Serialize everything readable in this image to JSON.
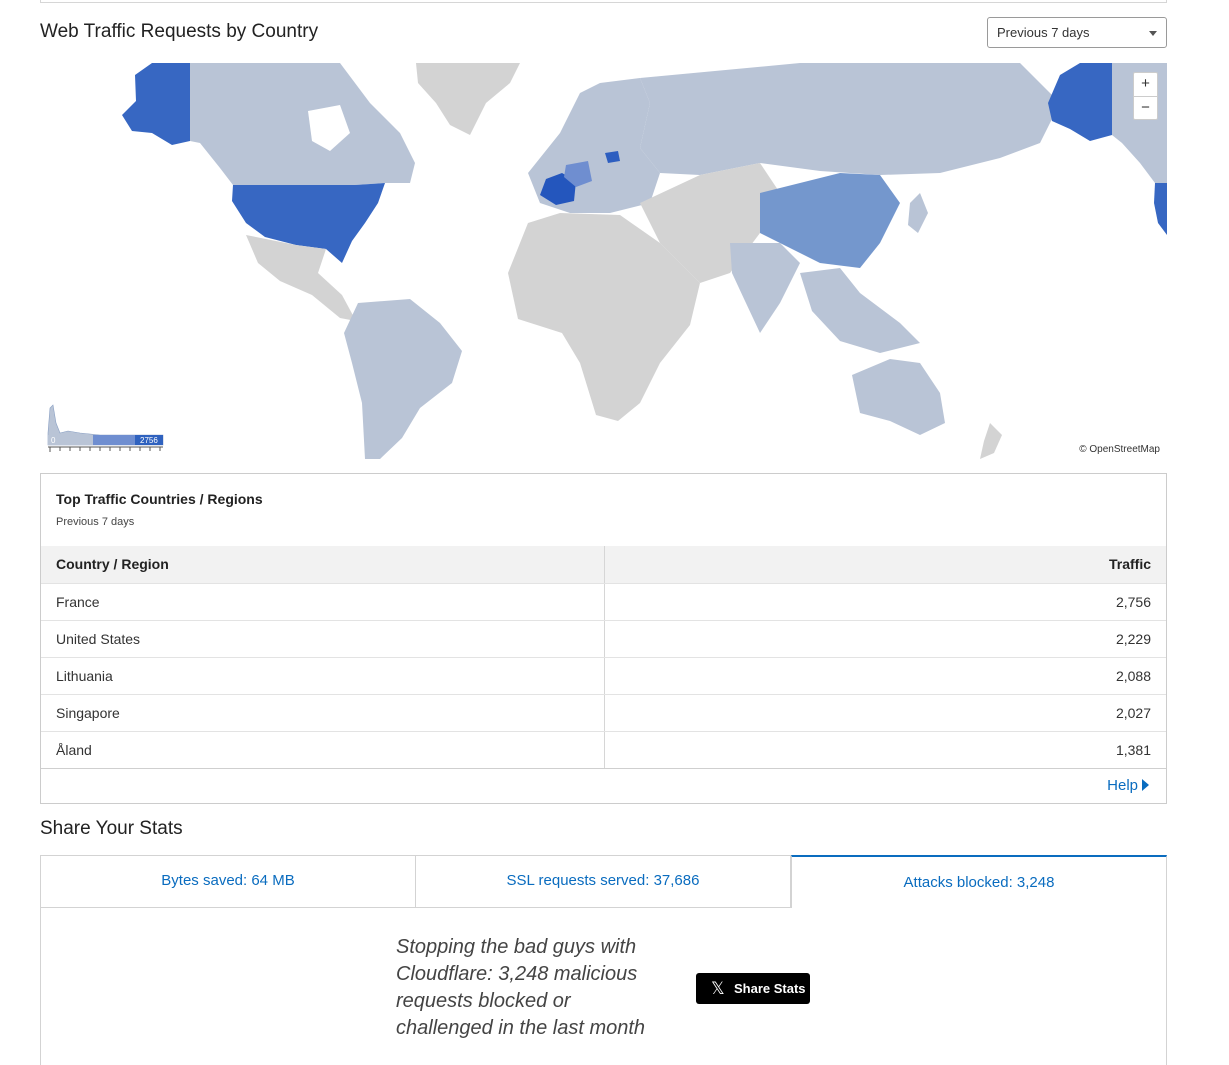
{
  "traffic": {
    "title": "Web Traffic Requests by Country",
    "period_select": "Previous 7 days"
  },
  "map": {
    "zoom_in": "+",
    "zoom_out": "−",
    "attribution": "© OpenStreetMap",
    "legend_min": "0",
    "legend_max": "2756",
    "colors": {
      "land": "#d3d3d3",
      "light": "#b9c4d6",
      "mid": "#8aa5d3",
      "high": "#5d84cb",
      "top": "#2f62bf"
    }
  },
  "top_countries": {
    "title": "Top Traffic Countries / Regions",
    "subtitle": "Previous 7 days",
    "headers": [
      "Country / Region",
      "Traffic"
    ],
    "rows": [
      {
        "country": "France",
        "traffic": "2,756"
      },
      {
        "country": "United States",
        "traffic": "2,229"
      },
      {
        "country": "Lithuania",
        "traffic": "2,088"
      },
      {
        "country": "Singapore",
        "traffic": "2,027"
      },
      {
        "country": "Åland",
        "traffic": "1,381"
      }
    ],
    "help": "Help"
  },
  "share": {
    "title": "Share Your Stats",
    "tabs": [
      "Bytes saved: 64 MB",
      "SSL requests served: 37,686",
      "Attacks blocked: 3,248"
    ],
    "active_tab": 2,
    "message": "Stopping the bad guys with Cloudflare: 3,248 malicious requests blocked or challenged in the last month",
    "button": "Share Stats",
    "accent": "#0a6cbf"
  }
}
